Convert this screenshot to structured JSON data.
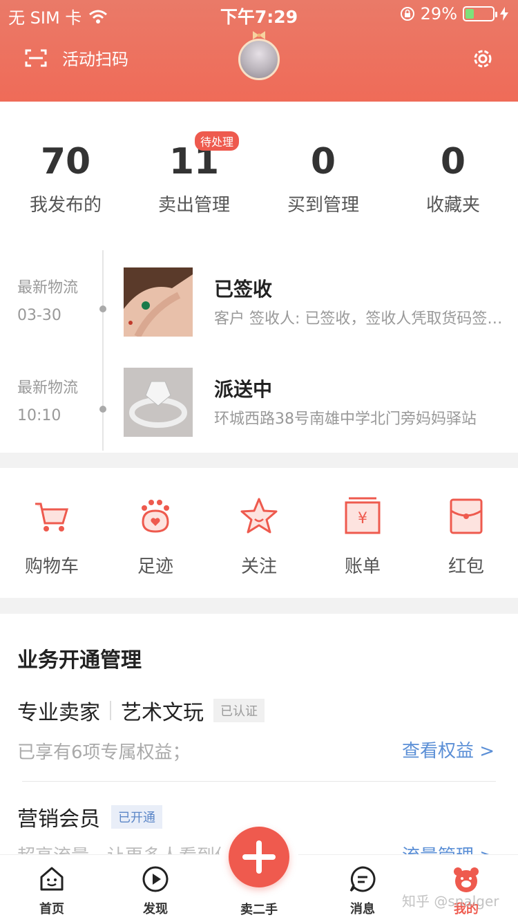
{
  "status_bar": {
    "carrier": "无 SIM 卡",
    "time": "下午7:29",
    "battery": "29%"
  },
  "header": {
    "scan_label": "活动扫码"
  },
  "stats": [
    {
      "value": "70",
      "label": "我发布的"
    },
    {
      "value": "11",
      "label": "卖出管理",
      "badge": "待处理"
    },
    {
      "value": "0",
      "label": "买到管理"
    },
    {
      "value": "0",
      "label": "收藏夹"
    }
  ],
  "shipments": [
    {
      "label": "最新物流",
      "date": "03-30",
      "status": "已签收",
      "desc": "客户 签收人: 已签收，签收人凭取货码签收。"
    },
    {
      "label": "最新物流",
      "date": "10:10",
      "status": "派送中",
      "desc": "环城西路38号南雄中学北门旁妈妈驿站"
    }
  ],
  "tools": [
    {
      "label": "购物车",
      "icon": "cart-icon"
    },
    {
      "label": "足迹",
      "icon": "paw-icon"
    },
    {
      "label": "关注",
      "icon": "star-icon"
    },
    {
      "label": "账单",
      "icon": "bill-icon"
    },
    {
      "label": "红包",
      "icon": "red-envelope-icon"
    }
  ],
  "business": {
    "title": "业务开通管理",
    "row1": {
      "a": "专业卖家",
      "b": "艺术文玩",
      "tag": "已认证",
      "sub": "已享有6项专属权益；",
      "link": "查看权益 >"
    },
    "row2": {
      "a": "营销会员",
      "tag": "已开通",
      "sub": "超高流量，让更多人看到你的宝贝",
      "link": "流量管理 >"
    }
  },
  "tabbar": {
    "home": "首页",
    "discover": "发现",
    "sell": "卖二手",
    "messages": "消息",
    "mine": "我的"
  },
  "watermark": "知乎 @snalger",
  "colors": {
    "brand": "#ee5a4e",
    "link": "#5b8fd6"
  }
}
